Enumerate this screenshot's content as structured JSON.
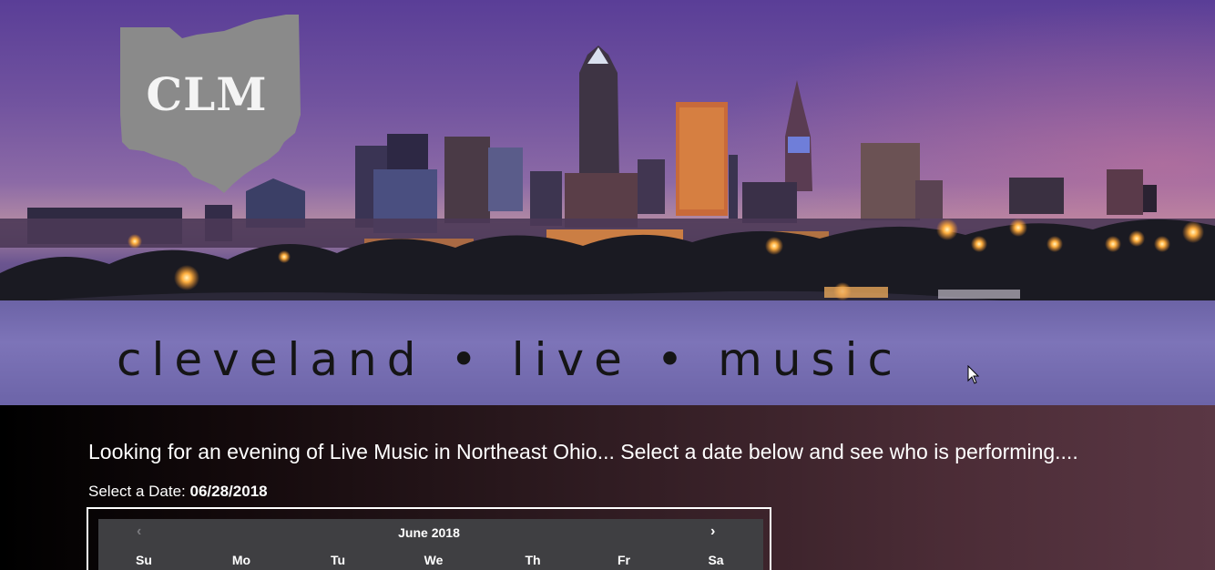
{
  "banner": {
    "logo_text": "CLM",
    "tagline": "cleveland • live • music"
  },
  "intro": {
    "text": "Looking for an evening of Live Music in Northeast Ohio... Select a date below and see who is performing...."
  },
  "date_select": {
    "label": "Select a Date:",
    "value": "06/28/2018"
  },
  "calendar": {
    "month_label": "June 2018",
    "prev_icon": "‹",
    "next_icon": "›",
    "weekdays": [
      "Su",
      "Mo",
      "Tu",
      "We",
      "Th",
      "Fr",
      "Sa"
    ]
  },
  "colors": {
    "calendar_bg": "#3f3f42",
    "frame_border": "#ffffff"
  }
}
